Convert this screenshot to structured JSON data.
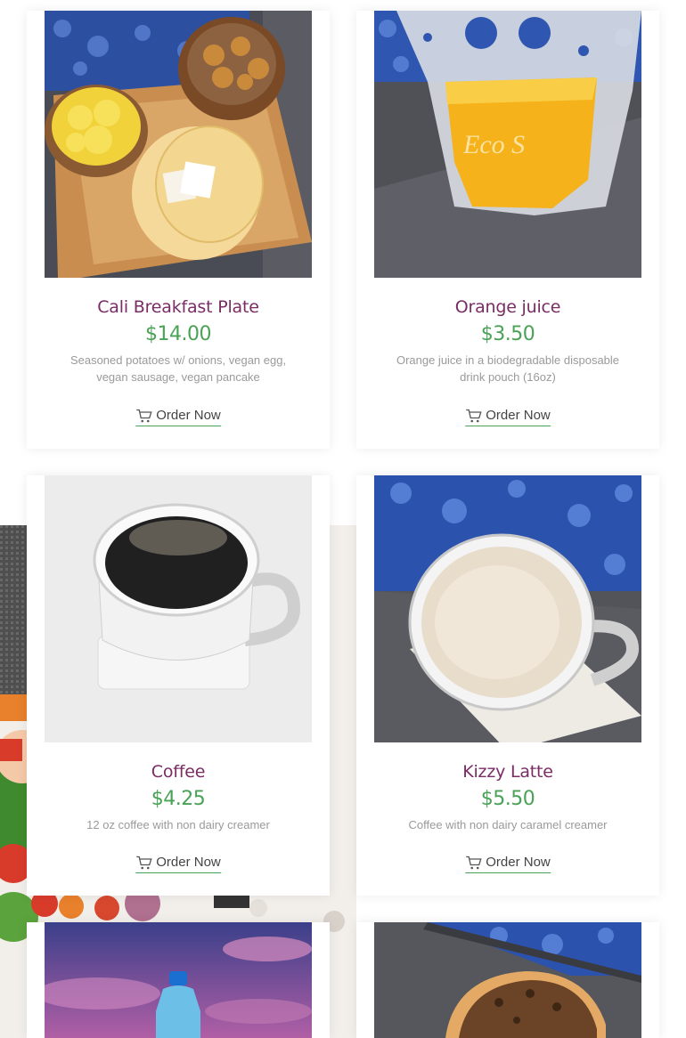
{
  "menu": {
    "items": [
      {
        "title": "Cali Breakfast Plate",
        "price": "$14.00",
        "description": "Seasoned potatoes w/ onions, vegan egg, vegan sausage, vegan pancake",
        "order_label": "Order Now"
      },
      {
        "title": "Orange juice",
        "price": "$3.50",
        "description": "Orange juice in a biodegradable disposable drink pouch (16oz)",
        "order_label": "Order Now"
      },
      {
        "title": "Coffee",
        "price": "$4.25",
        "description": "12 oz coffee with non dairy creamer",
        "order_label": "Order Now"
      },
      {
        "title": "Kizzy Latte",
        "price": "$5.50",
        "description": "Coffee with non dairy caramel creamer",
        "order_label": "Order Now"
      }
    ]
  },
  "icons": {
    "order": "cart-icon"
  },
  "colors": {
    "title": "#7a2c64",
    "price": "#4aa256",
    "underline": "#4aa256",
    "description": "#9a9a9a"
  }
}
